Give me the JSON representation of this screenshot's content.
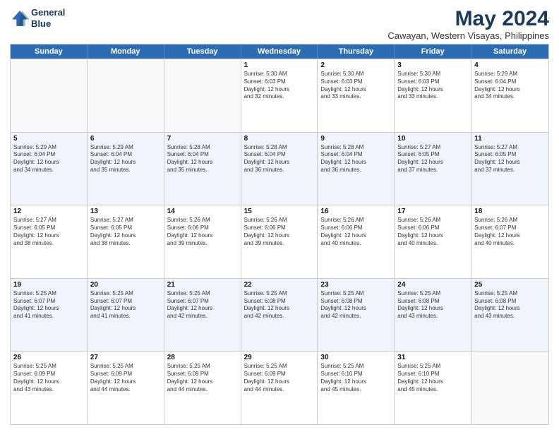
{
  "header": {
    "logo_line1": "General",
    "logo_line2": "Blue",
    "title": "May 2024",
    "subtitle": "Cawayan, Western Visayas, Philippines"
  },
  "weekdays": [
    "Sunday",
    "Monday",
    "Tuesday",
    "Wednesday",
    "Thursday",
    "Friday",
    "Saturday"
  ],
  "rows": [
    [
      {
        "day": "",
        "info": ""
      },
      {
        "day": "",
        "info": ""
      },
      {
        "day": "",
        "info": ""
      },
      {
        "day": "1",
        "info": "Sunrise: 5:30 AM\nSunset: 6:03 PM\nDaylight: 12 hours\nand 32 minutes."
      },
      {
        "day": "2",
        "info": "Sunrise: 5:30 AM\nSunset: 6:03 PM\nDaylight: 12 hours\nand 33 minutes."
      },
      {
        "day": "3",
        "info": "Sunrise: 5:30 AM\nSunset: 6:03 PM\nDaylight: 12 hours\nand 33 minutes."
      },
      {
        "day": "4",
        "info": "Sunrise: 5:29 AM\nSunset: 6:04 PM\nDaylight: 12 hours\nand 34 minutes."
      }
    ],
    [
      {
        "day": "5",
        "info": "Sunrise: 5:29 AM\nSunset: 6:04 PM\nDaylight: 12 hours\nand 34 minutes."
      },
      {
        "day": "6",
        "info": "Sunrise: 5:29 AM\nSunset: 6:04 PM\nDaylight: 12 hours\nand 35 minutes."
      },
      {
        "day": "7",
        "info": "Sunrise: 5:28 AM\nSunset: 6:04 PM\nDaylight: 12 hours\nand 35 minutes."
      },
      {
        "day": "8",
        "info": "Sunrise: 5:28 AM\nSunset: 6:04 PM\nDaylight: 12 hours\nand 36 minutes."
      },
      {
        "day": "9",
        "info": "Sunrise: 5:28 AM\nSunset: 6:04 PM\nDaylight: 12 hours\nand 36 minutes."
      },
      {
        "day": "10",
        "info": "Sunrise: 5:27 AM\nSunset: 6:05 PM\nDaylight: 12 hours\nand 37 minutes."
      },
      {
        "day": "11",
        "info": "Sunrise: 5:27 AM\nSunset: 6:05 PM\nDaylight: 12 hours\nand 37 minutes."
      }
    ],
    [
      {
        "day": "12",
        "info": "Sunrise: 5:27 AM\nSunset: 6:05 PM\nDaylight: 12 hours\nand 38 minutes."
      },
      {
        "day": "13",
        "info": "Sunrise: 5:27 AM\nSunset: 6:05 PM\nDaylight: 12 hours\nand 38 minutes."
      },
      {
        "day": "14",
        "info": "Sunrise: 5:26 AM\nSunset: 6:06 PM\nDaylight: 12 hours\nand 39 minutes."
      },
      {
        "day": "15",
        "info": "Sunrise: 5:26 AM\nSunset: 6:06 PM\nDaylight: 12 hours\nand 39 minutes."
      },
      {
        "day": "16",
        "info": "Sunrise: 5:26 AM\nSunset: 6:06 PM\nDaylight: 12 hours\nand 40 minutes."
      },
      {
        "day": "17",
        "info": "Sunrise: 5:26 AM\nSunset: 6:06 PM\nDaylight: 12 hours\nand 40 minutes."
      },
      {
        "day": "18",
        "info": "Sunrise: 5:26 AM\nSunset: 6:07 PM\nDaylight: 12 hours\nand 40 minutes."
      }
    ],
    [
      {
        "day": "19",
        "info": "Sunrise: 5:25 AM\nSunset: 6:07 PM\nDaylight: 12 hours\nand 41 minutes."
      },
      {
        "day": "20",
        "info": "Sunrise: 5:25 AM\nSunset: 6:07 PM\nDaylight: 12 hours\nand 41 minutes."
      },
      {
        "day": "21",
        "info": "Sunrise: 5:25 AM\nSunset: 6:07 PM\nDaylight: 12 hours\nand 42 minutes."
      },
      {
        "day": "22",
        "info": "Sunrise: 5:25 AM\nSunset: 6:08 PM\nDaylight: 12 hours\nand 42 minutes."
      },
      {
        "day": "23",
        "info": "Sunrise: 5:25 AM\nSunset: 6:08 PM\nDaylight: 12 hours\nand 42 minutes."
      },
      {
        "day": "24",
        "info": "Sunrise: 5:25 AM\nSunset: 6:08 PM\nDaylight: 12 hours\nand 43 minutes."
      },
      {
        "day": "25",
        "info": "Sunrise: 5:25 AM\nSunset: 6:08 PM\nDaylight: 12 hours\nand 43 minutes."
      }
    ],
    [
      {
        "day": "26",
        "info": "Sunrise: 5:25 AM\nSunset: 6:09 PM\nDaylight: 12 hours\nand 43 minutes."
      },
      {
        "day": "27",
        "info": "Sunrise: 5:25 AM\nSunset: 6:09 PM\nDaylight: 12 hours\nand 44 minutes."
      },
      {
        "day": "28",
        "info": "Sunrise: 5:25 AM\nSunset: 6:09 PM\nDaylight: 12 hours\nand 44 minutes."
      },
      {
        "day": "29",
        "info": "Sunrise: 5:25 AM\nSunset: 6:09 PM\nDaylight: 12 hours\nand 44 minutes."
      },
      {
        "day": "30",
        "info": "Sunrise: 5:25 AM\nSunset: 6:10 PM\nDaylight: 12 hours\nand 45 minutes."
      },
      {
        "day": "31",
        "info": "Sunrise: 5:25 AM\nSunset: 6:10 PM\nDaylight: 12 hours\nand 45 minutes."
      },
      {
        "day": "",
        "info": ""
      }
    ]
  ]
}
